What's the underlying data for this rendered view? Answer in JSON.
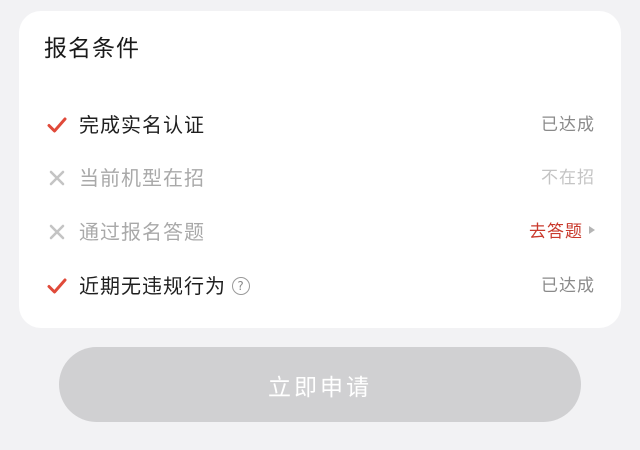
{
  "card": {
    "title": "报名条件",
    "conditions": [
      {
        "label": "完成实名认证",
        "met": true,
        "status": "已达成"
      },
      {
        "label": "当前机型在招",
        "met": false,
        "status": "不在招"
      },
      {
        "label": "通过报名答题",
        "met": false,
        "status": "去答题"
      },
      {
        "label": "近期无违规行为",
        "met": true,
        "status": "已达成",
        "help_icon": "?"
      }
    ]
  },
  "apply_button": {
    "label": "立即申请",
    "enabled": false
  },
  "colors": {
    "check": "#e04a3a",
    "cross": "#c4c4c4",
    "action": "#c9392c",
    "button_disabled": "#d0d0d2"
  },
  "icons": {
    "met": "check-icon",
    "unmet": "cross-icon",
    "help": "question-circle-icon",
    "arrow": "triangle-right-icon"
  }
}
